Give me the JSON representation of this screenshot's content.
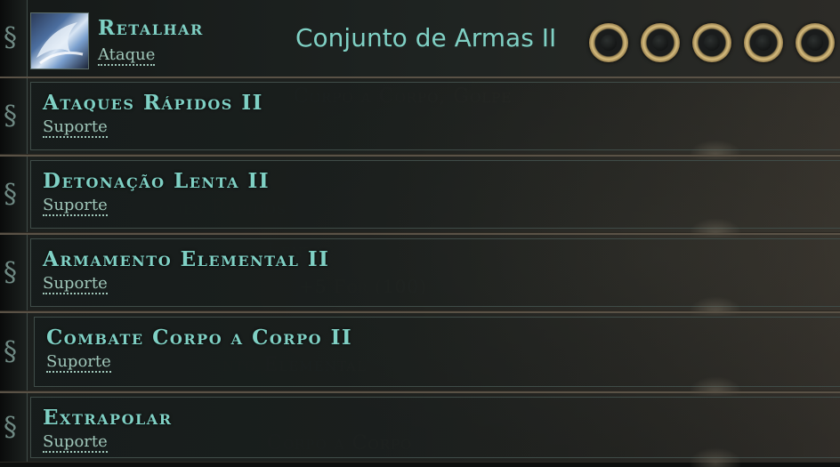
{
  "header": {
    "gem_name": "Retalhar",
    "gem_type": "Ataque",
    "weapon_set_label": "Conjunto de Armas II",
    "sockets": [
      "empty",
      "empty",
      "empty",
      "empty",
      "empty"
    ]
  },
  "support_gems": [
    {
      "name": "Ataques Rápidos II",
      "type": "Suporte"
    },
    {
      "name": "Detonação Lenta II",
      "type": "Suporte"
    },
    {
      "name": "Armamento Elemental II",
      "type": "Suporte"
    },
    {
      "name": "Combate Corpo a Corpo II",
      "type": "Suporte"
    },
    {
      "name": "Extrapolar",
      "type": "Suporte"
    }
  ],
  "colors": {
    "gem_name": "#7fd0c4",
    "gem_type": "#9fc6b9",
    "frame": "#5a5246"
  }
}
